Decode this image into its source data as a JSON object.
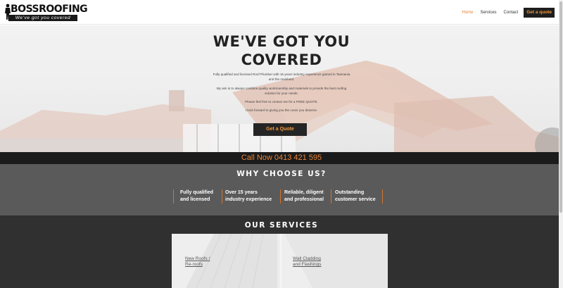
{
  "header": {
    "logo": {
      "boss": "BOSS",
      "roofing": "ROOFING",
      "tagline": "We've got you covered"
    },
    "nav": [
      {
        "label": "Home",
        "active": true
      },
      {
        "label": "Services",
        "active": false
      },
      {
        "label": "Contact",
        "active": false
      }
    ],
    "cta_label": "Get a quote"
  },
  "hero": {
    "title_line1": "WE'VE GOT YOU",
    "title_line2": "COVERED",
    "p1": "Fully qualified and licensed Roof Plumber with 15 years industry experience gained in Tasmania and the mainland.",
    "p2": "My aim is to always combine quality workmanship and materials to provide the best roofing solution for your needs.",
    "p3": "Please feel free to contact me for a FREE QUOTE.",
    "p4": "I look forward to giving you the cover you deserve.",
    "cta_label": "Get a Quote"
  },
  "callbar": {
    "text": "Call Now  0413 421 595"
  },
  "why": {
    "title": "WHY CHOOSE US?",
    "items": [
      {
        "line1": "Fully qualified",
        "line2": "and licensed"
      },
      {
        "line1": "Over 15 years",
        "line2": "industry experience"
      },
      {
        "line1": "Reliable, diligent",
        "line2": "and professional"
      },
      {
        "line1": "Outstanding",
        "line2": "customer service"
      }
    ]
  },
  "services": {
    "title": "OUR SERVICES",
    "cards": [
      {
        "line1": "New Roofs /",
        "line2": "Re-roofs"
      },
      {
        "line1": "Wall Cladding",
        "line2": "and Flashings"
      }
    ]
  },
  "colors": {
    "accent": "#e8843a",
    "dark": "#1b1b1b",
    "why_bg": "#5a5a5a",
    "services_bg": "#303030"
  }
}
